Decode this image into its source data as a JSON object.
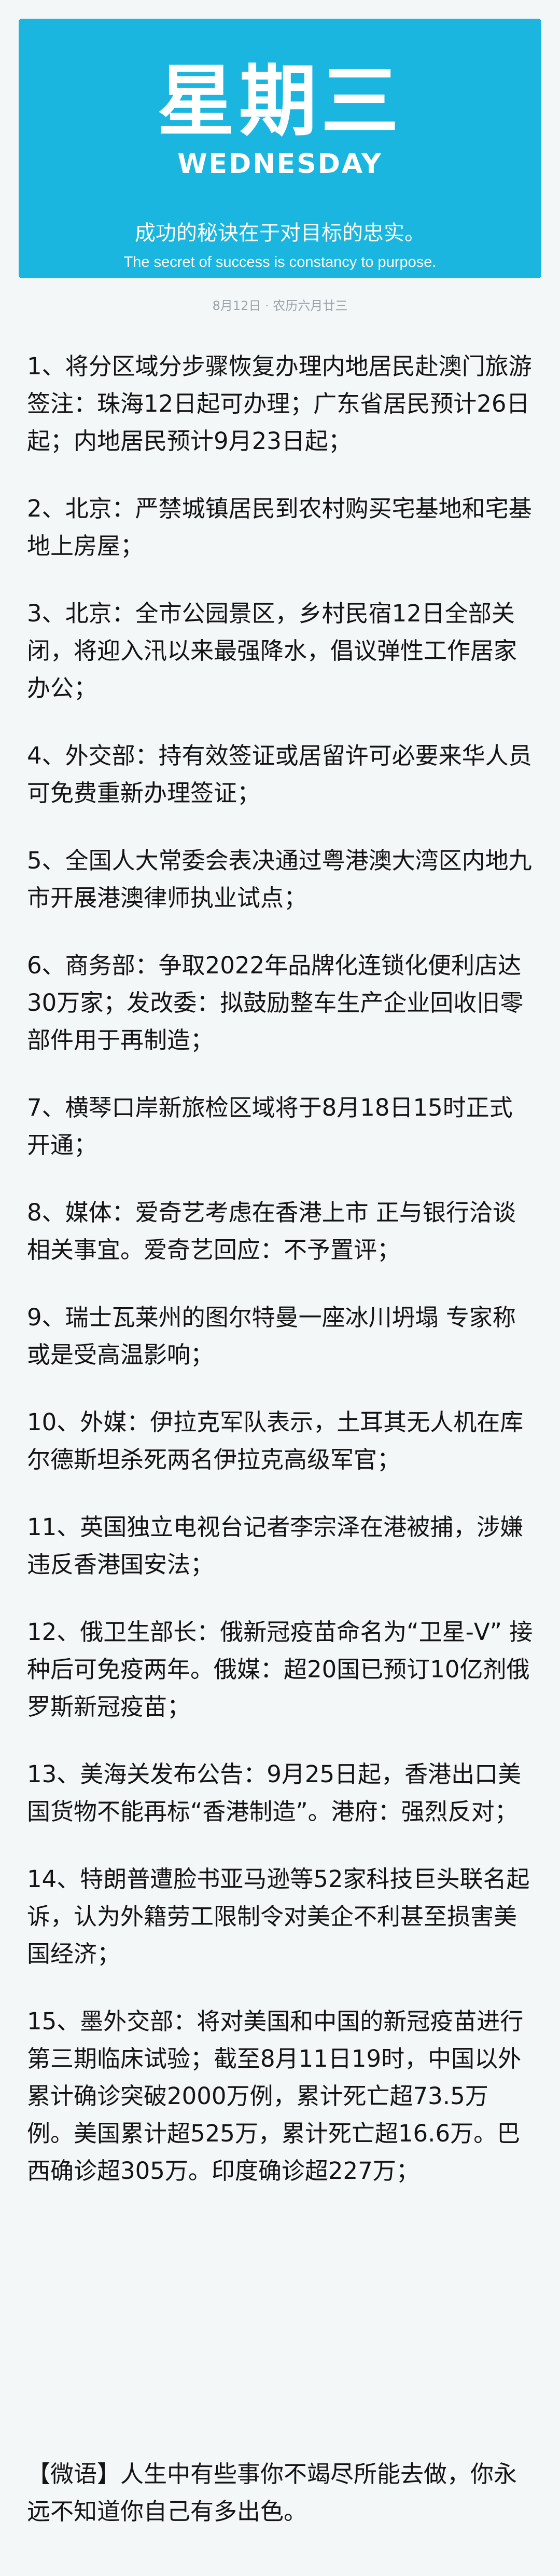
{
  "header": {
    "weekday_cn": "星期三",
    "weekday_en": "WEDNESDAY",
    "quote_cn": "成功的秘诀在于对目标的忠实。",
    "quote_en": "The secret of success is constancy to purpose.",
    "bg_color": "#1ab6df"
  },
  "date_line": "8月12日 · 农历六月廿三",
  "news": [
    "1、将分区域分步骤恢复办理内地居民赴澳门旅游签注：珠海12日起可办理；广东省居民预计26日起；内地居民预计9月23日起；",
    "2、北京：严禁城镇居民到农村购买宅基地和宅基地上房屋；",
    "3、北京：全市公园景区，乡村民宿12日全部关闭，将迎入汛以来最强降水，倡议弹性工作居家办公；",
    "4、外交部：持有效签证或居留许可必要来华人员可免费重新办理签证；",
    "5、全国人大常委会表决通过粤港澳大湾区内地九市开展港澳律师执业试点；",
    "6、商务部：争取2022年品牌化连锁化便利店达30万家；发改委：拟鼓励整车生产企业回收旧零部件用于再制造；",
    "7、横琴口岸新旅检区域将于8月18日15时正式开通；",
    "8、媒体：爱奇艺考虑在香港上市 正与银行洽谈相关事宜。爱奇艺回应：不予置评；",
    "9、瑞士瓦莱州的图尔特曼一座冰川坍塌 专家称或是受高温影响；",
    "10、外媒：伊拉克军队表示，土耳其无人机在库尔德斯坦杀死两名伊拉克高级军官；",
    "11、英国独立电视台记者李宗泽在港被捕，涉嫌违反香港国安法；",
    "12、俄卫生部长：俄新冠疫苗命名为“卫星-V” 接种后可免疫两年。俄媒：超20国已预订10亿剂俄罗斯新冠疫苗；",
    "13、美海关发布公告：9月25日起，香港出口美国货物不能再标“香港制造”。港府：强烈反对；",
    "14、特朗普遭脸书亚马逊等52家科技巨头联名起诉，认为外籍劳工限制令对美企不利甚至损害美国经济；",
    "15、墨外交部：将对美国和中国的新冠疫苗进行第三期临床试验；截至8月11日19时，中国以外累计确诊突破2000万例，累计死亡超73.5万例。美国累计超525万，累计死亡超16.6万。巴西确诊超305万。印度确诊超227万；"
  ],
  "motto": "【微语】人生中有些事你不竭尽所能去做，你永远不知道你自己有多出色。"
}
